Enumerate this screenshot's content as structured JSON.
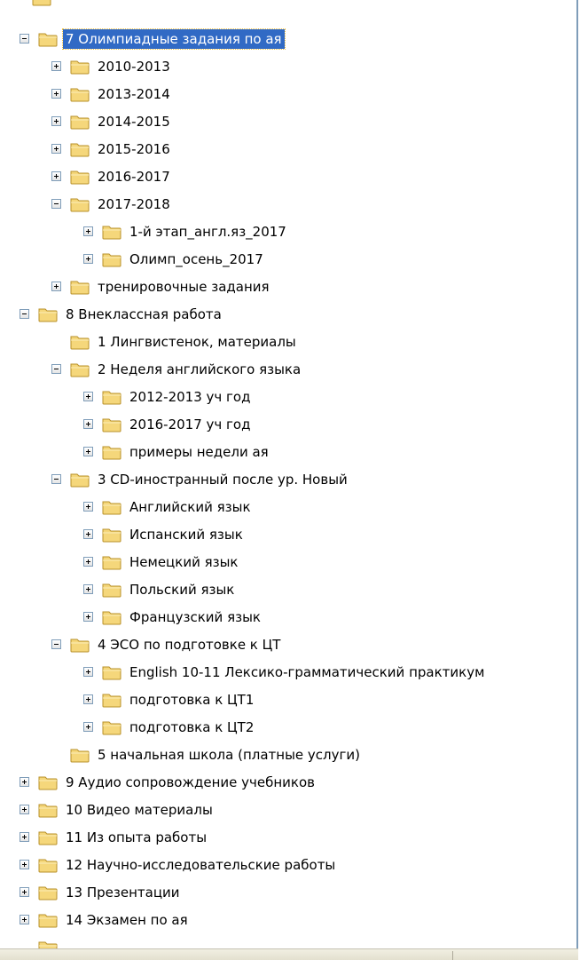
{
  "tree": {
    "items": [
      {
        "label": "7 Олимпиадные задания по ая",
        "toggle": "minus",
        "selected": true
      },
      {
        "label": "2010-2013",
        "toggle": "plus"
      },
      {
        "label": "2013-2014",
        "toggle": "plus"
      },
      {
        "label": "2014-2015",
        "toggle": "plus"
      },
      {
        "label": "2015-2016",
        "toggle": "plus"
      },
      {
        "label": "2016-2017",
        "toggle": "plus"
      },
      {
        "label": "2017-2018",
        "toggle": "minus"
      },
      {
        "label": "1-й этап_англ.яз_2017",
        "toggle": "plus"
      },
      {
        "label": "Олимп_осень_2017",
        "toggle": "plus"
      },
      {
        "label": "тренировочные задания",
        "toggle": "plus"
      },
      {
        "label": "8 Внеклассная работа",
        "toggle": "minus"
      },
      {
        "label": "1 Лингвистенок, материалы",
        "toggle": "none"
      },
      {
        "label": "2 Неделя английского языка",
        "toggle": "minus"
      },
      {
        "label": "2012-2013 уч год",
        "toggle": "plus"
      },
      {
        "label": "2016-2017 уч год",
        "toggle": "plus"
      },
      {
        "label": "примеры недели ая",
        "toggle": "plus"
      },
      {
        "label": "3 CD-иностранный после ур. Новый",
        "toggle": "minus"
      },
      {
        "label": "Английский язык",
        "toggle": "plus"
      },
      {
        "label": "Испанский язык",
        "toggle": "plus"
      },
      {
        "label": "Немецкий язык",
        "toggle": "plus"
      },
      {
        "label": "Польский язык",
        "toggle": "plus"
      },
      {
        "label": "Французский язык",
        "toggle": "plus"
      },
      {
        "label": "4 ЭСО по подготовке к ЦТ",
        "toggle": "minus"
      },
      {
        "label": "English 10-11 Лексико-грамматический практикум",
        "toggle": "plus"
      },
      {
        "label": "подготовка к ЦТ1",
        "toggle": "plus"
      },
      {
        "label": "подготовка к ЦТ2",
        "toggle": "plus"
      },
      {
        "label": "5 начальная школа (платные услуги)",
        "toggle": "none"
      },
      {
        "label": "9 Аудио сопровождение учебников",
        "toggle": "plus"
      },
      {
        "label": "10 Видео материалы",
        "toggle": "plus"
      },
      {
        "label": "11 Из опыта работы",
        "toggle": "plus"
      },
      {
        "label": "12 Научно-исследовательские работы",
        "toggle": "plus"
      },
      {
        "label": "13 Презентации",
        "toggle": "plus"
      },
      {
        "label": "14 Экзамен по ая",
        "toggle": "plus"
      }
    ]
  },
  "colors": {
    "selection": "#316ac5",
    "folder": "#f5d77b",
    "folder_edge": "#b8902a"
  }
}
